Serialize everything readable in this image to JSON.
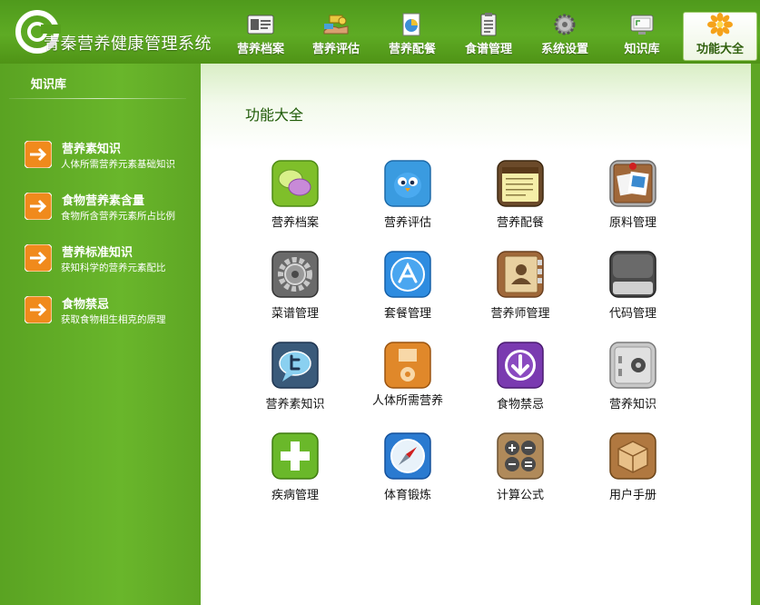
{
  "header": {
    "app_title": "青秦营养健康管理系统",
    "nav": [
      {
        "label": "营养档案",
        "icon": "profile-card-icon"
      },
      {
        "label": "营养评估",
        "icon": "hand-coins-icon"
      },
      {
        "label": "营养配餐",
        "icon": "pie-chart-icon"
      },
      {
        "label": "食谱管理",
        "icon": "clipboard-icon"
      },
      {
        "label": "系统设置",
        "icon": "gear-icon"
      },
      {
        "label": "知识库",
        "icon": "monitor-icon"
      },
      {
        "label": "功能大全",
        "icon": "flower-icon",
        "active": true
      }
    ]
  },
  "sidebar": {
    "title": "知识库",
    "items": [
      {
        "title": "营养素知识",
        "desc": "人体所需营养元素基础知识"
      },
      {
        "title": "食物营养素含量",
        "desc": "食物所含营养元素所占比例"
      },
      {
        "title": "营养标准知识",
        "desc": "获知科学的营养元素配比"
      },
      {
        "title": "食物禁忌",
        "desc": "获取食物相生相克的原理"
      }
    ]
  },
  "main": {
    "title": "功能大全",
    "tiles": [
      {
        "label": "营养档案",
        "icon": "chat-bubbles-icon"
      },
      {
        "label": "营养评估",
        "icon": "bird-icon"
      },
      {
        "label": "营养配餐",
        "icon": "notepad-icon"
      },
      {
        "label": "原料管理",
        "icon": "photo-board-icon"
      },
      {
        "label": "菜谱管理",
        "icon": "gear-icon"
      },
      {
        "label": "套餐管理",
        "icon": "app-store-icon"
      },
      {
        "label": "营养师管理",
        "icon": "address-book-icon"
      },
      {
        "label": "代码管理",
        "icon": "dark-panel-icon"
      },
      {
        "label": "营养素知识",
        "icon": "speech-bubble-icon"
      },
      {
        "label": "人体所需营养",
        "icon": "music-player-icon"
      },
      {
        "label": "食物禁忌",
        "icon": "download-icon"
      },
      {
        "label": "营养知识",
        "icon": "safe-icon"
      },
      {
        "label": "疾病管理",
        "icon": "plus-icon"
      },
      {
        "label": "体育锻炼",
        "icon": "compass-icon"
      },
      {
        "label": "计算公式",
        "icon": "calculator-icon"
      },
      {
        "label": "用户手册",
        "icon": "package-icon"
      }
    ]
  },
  "colors": {
    "header_green": "#5eab24",
    "sidebar_green": "#69b62b",
    "title_green": "#1f5a07",
    "arrow_orange": "#f08a1c"
  }
}
